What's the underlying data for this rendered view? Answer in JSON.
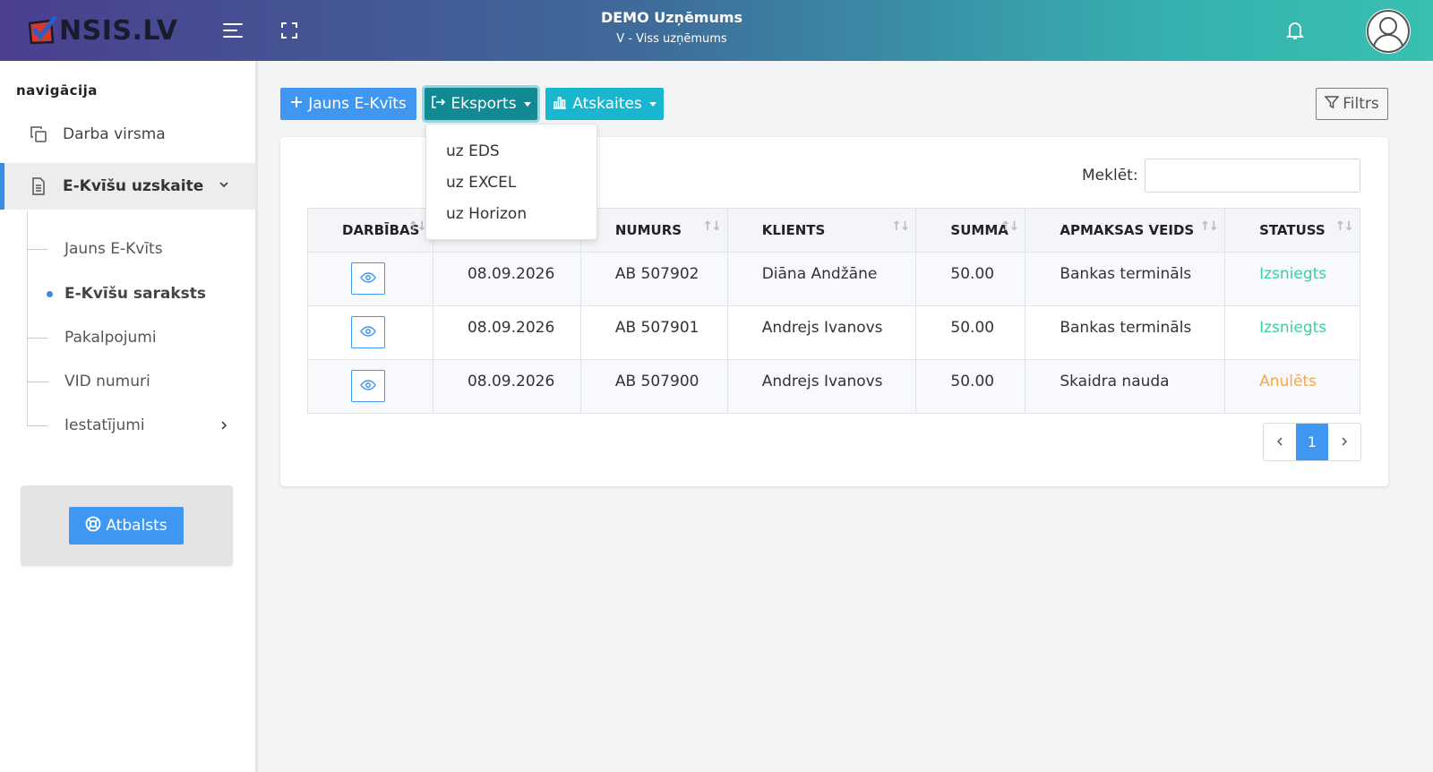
{
  "header": {
    "logo_text": "NSIS.LV",
    "company_name": "DEMO Uzņēmums",
    "company_sub": "V - Viss uzņēmums"
  },
  "sidebar": {
    "heading": "navigācija",
    "items": [
      {
        "label": "Darba virsma",
        "icon": "copy-icon"
      },
      {
        "label": "E-Kvīšu uzskaite",
        "icon": "document-icon"
      }
    ],
    "subitems": [
      {
        "label": "Jauns E-Kvīts"
      },
      {
        "label": "E-Kvīšu saraksts"
      },
      {
        "label": "Pakalpojumi"
      },
      {
        "label": "VID numuri"
      },
      {
        "label": "Iestatījumi"
      }
    ],
    "support_label": "Atbalsts"
  },
  "toolbar": {
    "new_label": "Jauns E-Kvīts",
    "export_label": "Eksports",
    "reports_label": "Atskaites",
    "filter_label": "Filtrs"
  },
  "export_menu": {
    "items": [
      "uz EDS",
      "uz EXCEL",
      "uz Horizon"
    ]
  },
  "search": {
    "label": "Meklēt:",
    "value": ""
  },
  "table": {
    "columns": [
      "DARBĪBAS",
      "",
      "NUMURS",
      "KLIENTS",
      "SUMMA",
      "APMAKSAS VEIDS",
      "STATUSS"
    ],
    "rows": [
      {
        "date": "08.09.2026",
        "number": "AB 507902",
        "client": "Diāna Andžāne",
        "sum": "50.00",
        "payment": "Bankas termināls",
        "status": "Izsniegts"
      },
      {
        "date": "08.09.2026",
        "number": "AB 507901",
        "client": "Andrejs Ivanovs",
        "sum": "50.00",
        "payment": "Bankas termināls",
        "status": "Izsniegts"
      },
      {
        "date": "08.09.2026",
        "number": "AB 507900",
        "client": "Andrejs Ivanovs",
        "sum": "50.00",
        "payment": "Skaidra nauda",
        "status": "Anulēts"
      }
    ]
  },
  "pagination": {
    "current_page": "1"
  },
  "colors": {
    "primary": "#3f97f2",
    "export": "#118a93",
    "reports": "#19b6d0",
    "status_ok": "#3ccf9e",
    "status_cancel": "#f5a94a"
  }
}
